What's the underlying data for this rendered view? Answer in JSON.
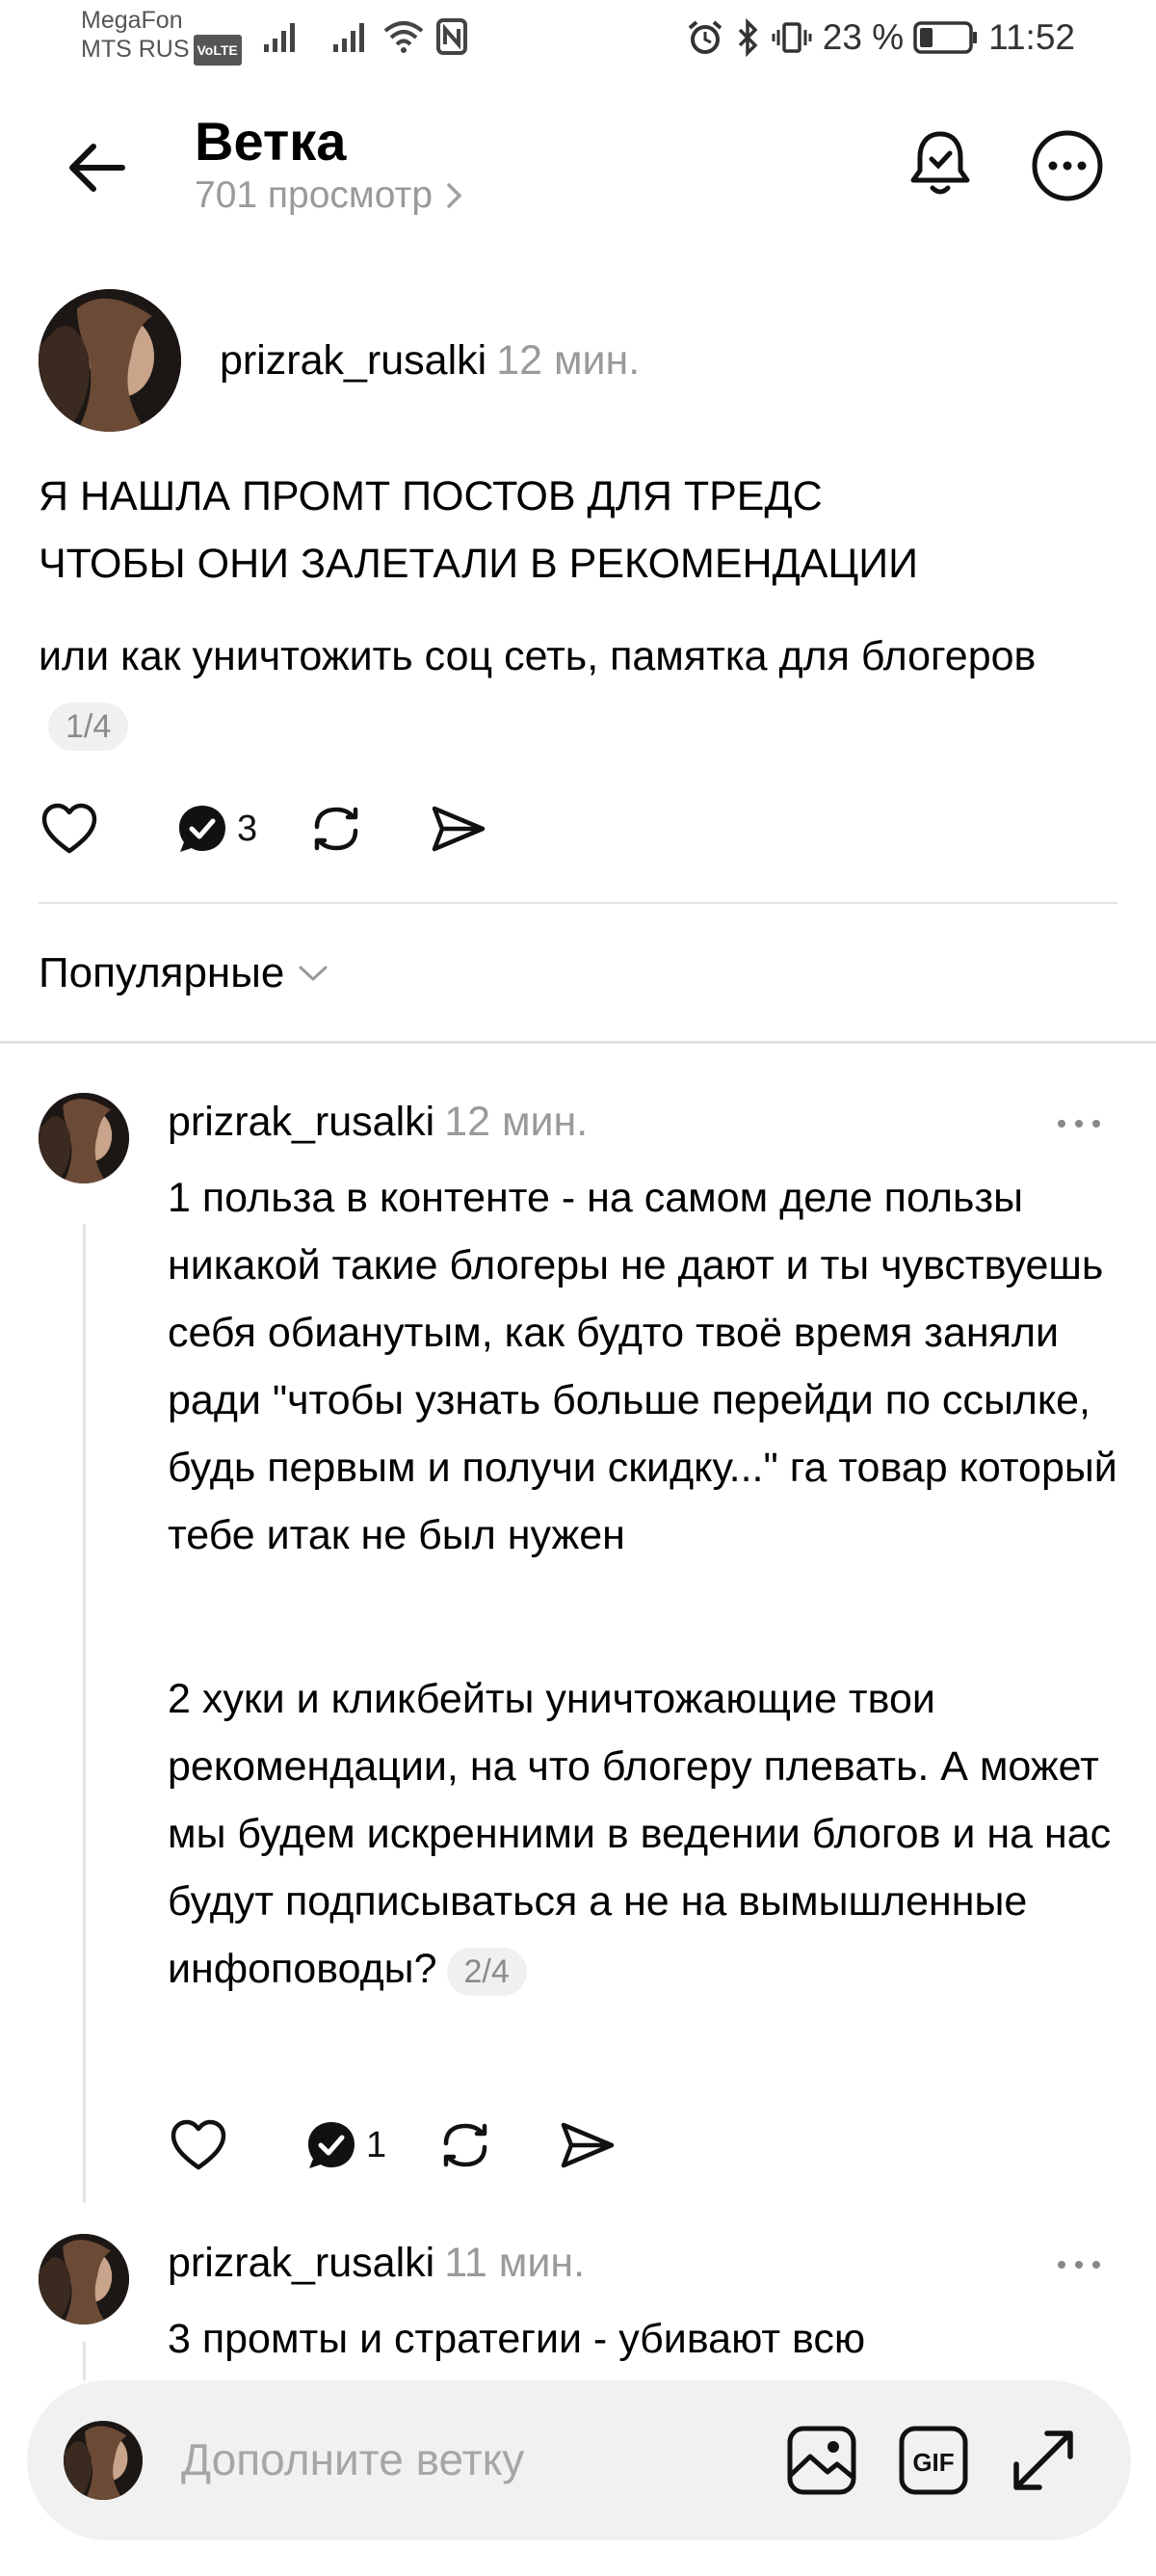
{
  "status_bar": {
    "carrier_1": "MegaFon",
    "carrier_2": "MTS RUS",
    "volte_badge": "VoLTE",
    "battery_percent": "23 %",
    "time": "11:52"
  },
  "header": {
    "title": "Ветка",
    "views": "701 просмотр"
  },
  "main_post": {
    "username": "prizrak_rusalki",
    "time": "12 мин.",
    "headline_line1": "Я НАШЛА ПРОМТ ПОСТОВ ДЛЯ ТРЕДС",
    "headline_line2": "ЧТОБЫ ОНИ ЗАЛЕТАЛИ В РЕКОМЕНДАЦИИ",
    "body": "или как уничтожить соц сеть, памятка для блогеров",
    "page_indicator": "1/4",
    "reply_count": "3"
  },
  "sort": {
    "label": "Популярные"
  },
  "replies": [
    {
      "username": "prizrak_rusalki",
      "time": "12 мин.",
      "paragraph_1": "1 польза в контенте - на самом деле пользы никакой такие блогеры не дают и ты чувствуешь себя обианутым, как будто твоё время заняли ради \"чтобы узнать больше перейди по ссылке, будь первым и получи скидку...\" га товар который тебе итак не был нужен",
      "paragraph_2": "2 хуки и кликбейты уничтожающие твои рекомендации, на что блогеру плевать. А может мы будем искренними в ведении блогов и на нас будут подписываться а не на вымышленные инфоповоды?",
      "page_indicator": "2/4",
      "reply_count": "1"
    },
    {
      "username": "prizrak_rusalki",
      "time": "11 мин.",
      "paragraph_1": "3 промты и стратегии - убивают всю"
    }
  ],
  "composer": {
    "placeholder": "Дополните ветку",
    "gif_label": "GIF"
  }
}
